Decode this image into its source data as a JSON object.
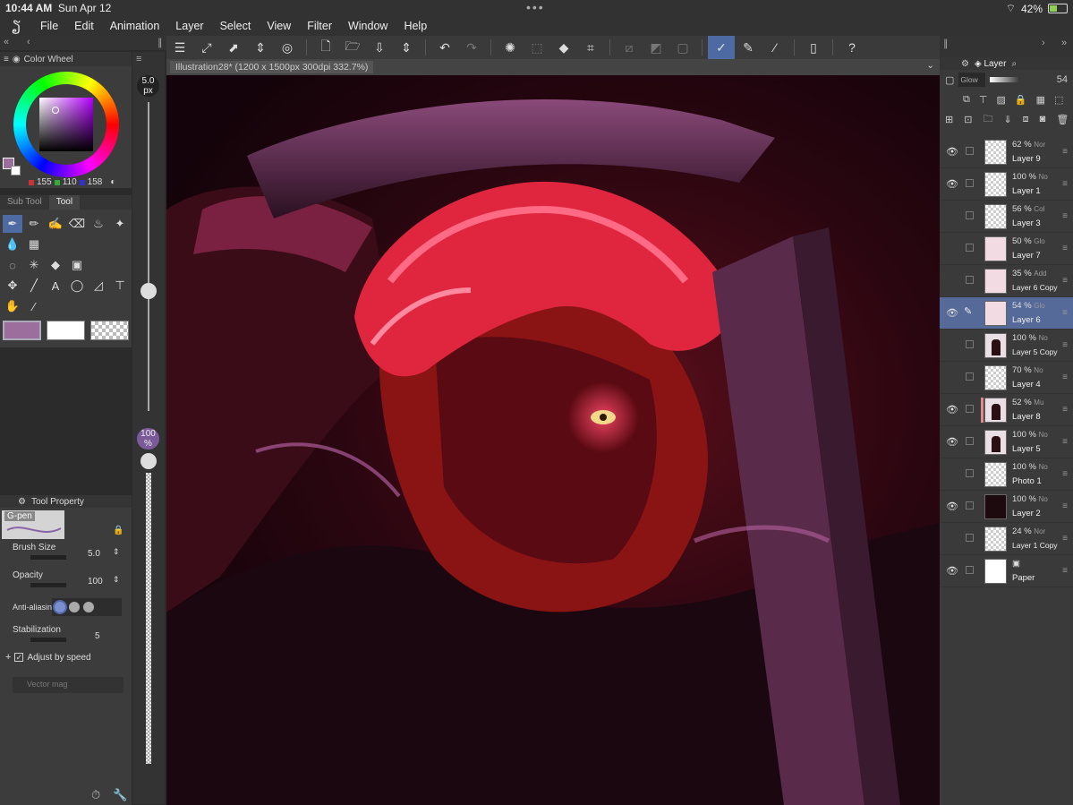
{
  "status": {
    "time": "10:44 AM",
    "date": "Sun Apr 12",
    "battery": "42%",
    "battery_level": 0.42
  },
  "menu": [
    "File",
    "Edit",
    "Animation",
    "Layer",
    "Select",
    "View",
    "Filter",
    "Window",
    "Help"
  ],
  "color_wheel": {
    "title": "Color Wheel",
    "r": "155",
    "g": "110",
    "b": "158",
    "main_color": "#9b6e9e"
  },
  "tool_panel": {
    "tab_subtool": "Sub Tool",
    "tab_tool": "Tool"
  },
  "brush": {
    "size_badge": "5.0",
    "size_unit": "px",
    "opacity_badge": "100",
    "opacity_unit": "%"
  },
  "tool_property": {
    "title": "Tool Property",
    "brush_name": "G-pen",
    "brush_size_label": "Brush Size",
    "brush_size_value": "5.0",
    "opacity_label": "Opacity",
    "opacity_value": "100",
    "antialias_label": "Anti-aliasing",
    "stabilization_label": "Stabilization",
    "stabilization_value": "5",
    "adjust_label": "Adjust by speed",
    "vector_label": "Vector mag"
  },
  "document": {
    "tab": "Illustration28* (1200 x 1500px 300dpi 332.7%)"
  },
  "layer_panel": {
    "title": "Layer",
    "blend": "Glow",
    "opacity": "54",
    "layers": [
      {
        "pct": "62 %",
        "mode": "Nor",
        "name": "Layer 9",
        "visible": true,
        "thumb": "check"
      },
      {
        "pct": "100 %",
        "mode": "No",
        "name": "Layer 1",
        "visible": true,
        "thumb": "check"
      },
      {
        "pct": "56 %",
        "mode": "Col",
        "name": "Layer 3",
        "visible": false,
        "thumb": "check"
      },
      {
        "pct": "50 %",
        "mode": "Glo",
        "name": "Layer 7",
        "visible": false,
        "thumb": "pink"
      },
      {
        "pct": "35 %",
        "mode": "Add",
        "name": "Layer 6 Copy",
        "visible": false,
        "thumb": "pink"
      },
      {
        "pct": "54 %",
        "mode": "Glo",
        "name": "Layer 6",
        "visible": true,
        "thumb": "pink",
        "selected": true
      },
      {
        "pct": "100 %",
        "mode": "No",
        "name": "Layer 5 Copy",
        "visible": false,
        "thumb": "fig"
      },
      {
        "pct": "70 %",
        "mode": "No",
        "name": "Layer 4",
        "visible": false,
        "thumb": "check"
      },
      {
        "pct": "52 %",
        "mode": "Mu",
        "name": "Layer 8",
        "visible": true,
        "thumb": "fig",
        "clipped": true
      },
      {
        "pct": "100 %",
        "mode": "No",
        "name": "Layer 5",
        "visible": true,
        "thumb": "fig"
      },
      {
        "pct": "100 %",
        "mode": "No",
        "name": "Photo 1",
        "visible": false,
        "thumb": "check"
      },
      {
        "pct": "100 %",
        "mode": "No",
        "name": "Layer 2",
        "visible": true,
        "thumb": "dark"
      },
      {
        "pct": "24 %",
        "mode": "Nor",
        "name": "Layer 1 Copy",
        "visible": false,
        "thumb": "check"
      },
      {
        "pct": "",
        "mode": "",
        "name": "Paper",
        "visible": true,
        "thumb": "white"
      }
    ]
  }
}
